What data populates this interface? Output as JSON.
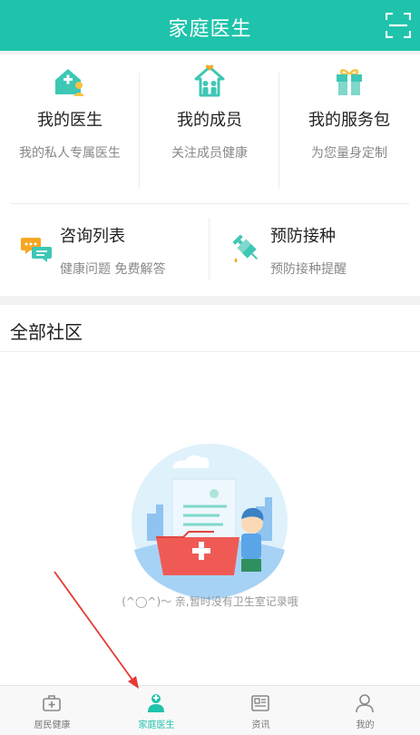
{
  "header": {
    "title": "家庭医生",
    "scan_icon": "scan-icon"
  },
  "features": [
    {
      "title": "我的医生",
      "subtitle": "我的私人专属医生",
      "icon": "house-doctor-icon"
    },
    {
      "title": "我的成员",
      "subtitle": "关注成员健康",
      "icon": "family-home-icon"
    },
    {
      "title": "我的服务包",
      "subtitle": "为您量身定制",
      "icon": "gift-icon"
    }
  ],
  "shortcuts": [
    {
      "title": "咨询列表",
      "subtitle": "健康问题 免费解答",
      "icon": "chat-bubbles-icon"
    },
    {
      "title": "预防接种",
      "subtitle": "预防接种提醒",
      "icon": "syringe-icon"
    }
  ],
  "community": {
    "title": "全部社区",
    "empty_text": "(^◯^)～ 亲,暂时没有卫生室记录哦"
  },
  "tabbar": {
    "active": 1,
    "tabs": [
      {
        "label": "居民健康",
        "icon": "medical-kit-icon"
      },
      {
        "label": "家庭医生",
        "icon": "doctor-icon"
      },
      {
        "label": "资讯",
        "icon": "news-icon"
      },
      {
        "label": "我的",
        "icon": "user-icon"
      }
    ]
  },
  "colors": {
    "accent": "#1fc3ab",
    "annotation_arrow": "#e53935"
  }
}
